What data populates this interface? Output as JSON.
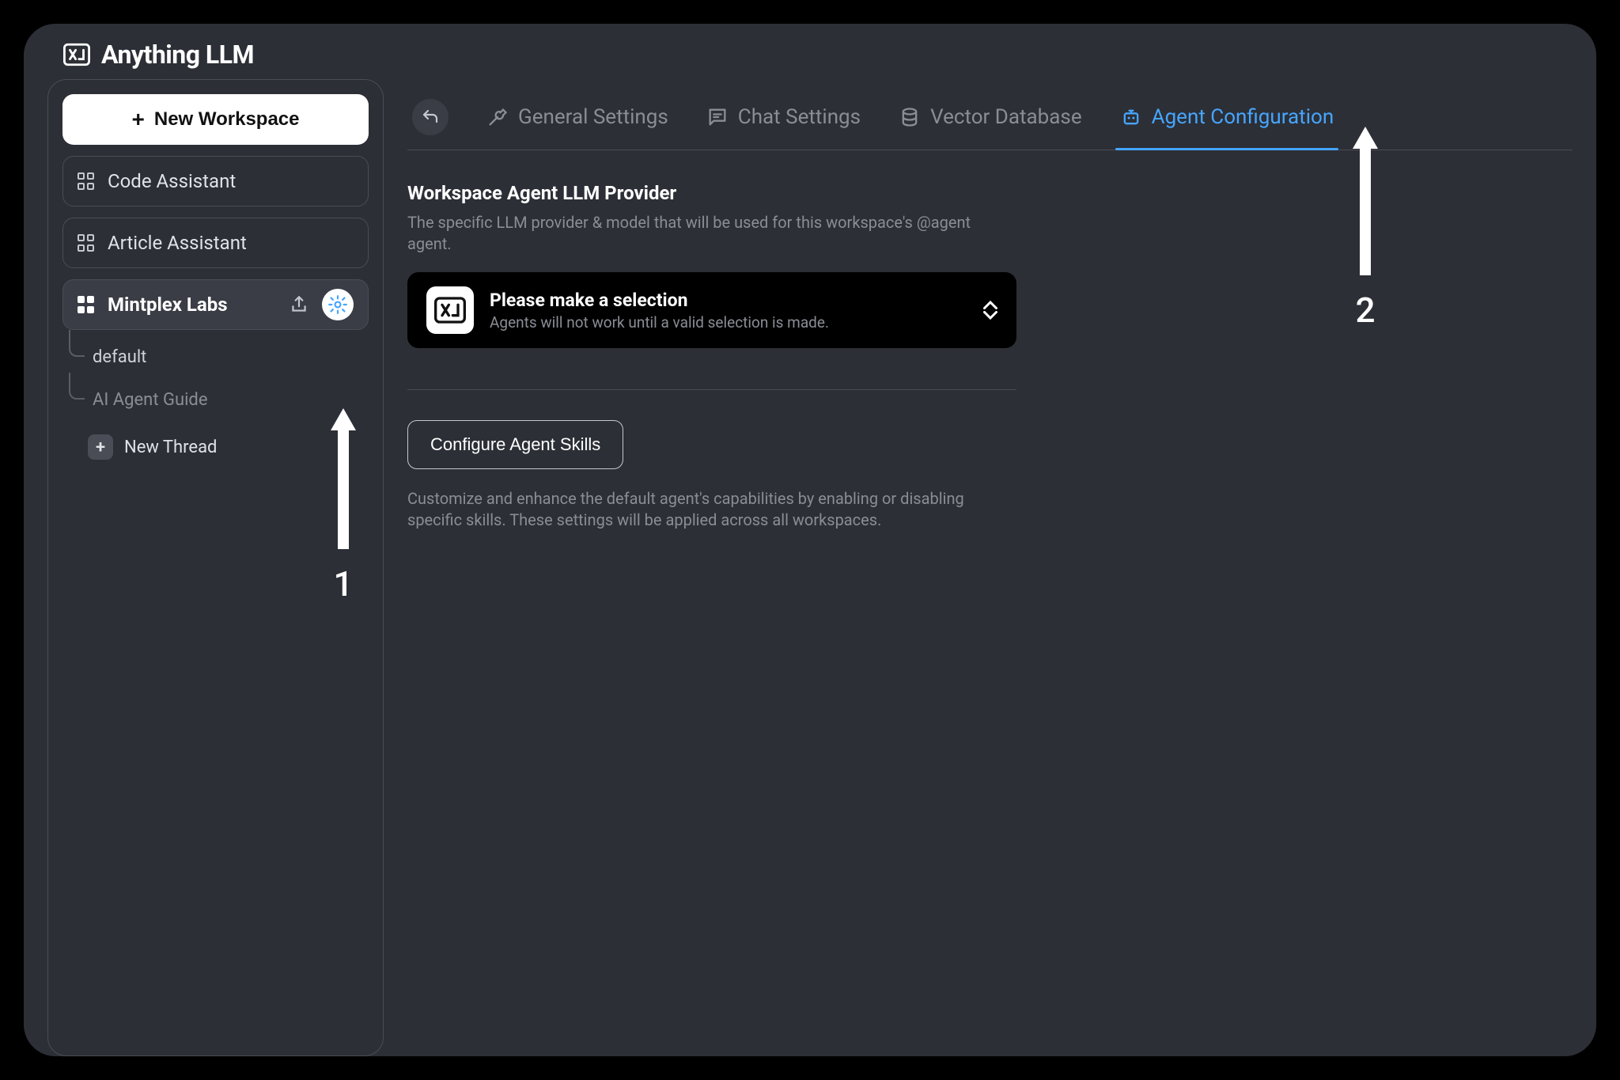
{
  "app": {
    "title": "Anything LLM"
  },
  "sidebar": {
    "new_workspace_label": "New Workspace",
    "workspaces": [
      {
        "label": "Code Assistant",
        "active": false
      },
      {
        "label": "Article Assistant",
        "active": false
      },
      {
        "label": "Mintplex Labs",
        "active": true
      }
    ],
    "threads": [
      {
        "label": "default",
        "muted": false
      },
      {
        "label": "AI Agent Guide",
        "muted": true
      }
    ],
    "new_thread_label": "New Thread"
  },
  "tabs": [
    {
      "label": "General Settings",
      "icon": "wrench",
      "active": false
    },
    {
      "label": "Chat Settings",
      "icon": "chat",
      "active": false
    },
    {
      "label": "Vector Database",
      "icon": "database",
      "active": false
    },
    {
      "label": "Agent Configuration",
      "icon": "robot",
      "active": true
    }
  ],
  "section": {
    "title": "Workspace Agent LLM Provider",
    "desc": "The specific LLM provider & model that will be used for this workspace's @agent agent."
  },
  "provider": {
    "title": "Please make a selection",
    "sub": "Agents will not work until a valid selection is made."
  },
  "skills": {
    "button_label": "Configure Agent Skills",
    "desc": "Customize and enhance the default agent's capabilities by enabling or disabling specific skills. These settings will be applied across all workspaces."
  },
  "annotations": {
    "one": "1",
    "two": "2"
  }
}
